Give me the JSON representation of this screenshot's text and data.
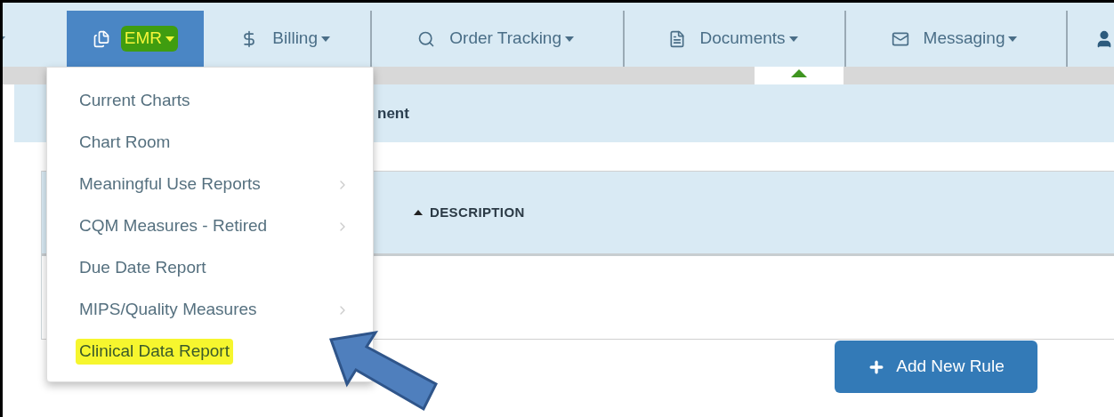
{
  "navbar": {
    "items": [
      {
        "label": "EMR",
        "selected": true,
        "highlighted": true
      },
      {
        "label": "Billing",
        "selected": false,
        "highlighted": false
      },
      {
        "label": "Order Tracking",
        "selected": false,
        "highlighted": false
      },
      {
        "label": "Documents",
        "selected": false,
        "highlighted": false
      },
      {
        "label": "Messaging",
        "selected": false,
        "highlighted": false
      }
    ]
  },
  "emr_menu": {
    "items": [
      {
        "label": "Current Charts",
        "kind": "plain",
        "highlighted": false
      },
      {
        "label": "Chart Room",
        "kind": "plain",
        "highlighted": false
      },
      {
        "label": "Meaningful Use Reports",
        "kind": "submenu",
        "highlighted": false
      },
      {
        "label": "CQM Measures - Retired",
        "kind": "submenu",
        "highlighted": false
      },
      {
        "label": "Due Date Report",
        "kind": "plain",
        "highlighted": false
      },
      {
        "label": "MIPS/Quality Measures",
        "kind": "submenu",
        "highlighted": false
      },
      {
        "label": "Clinical Data Report",
        "kind": "plain",
        "highlighted": true
      }
    ]
  },
  "panel": {
    "title_end": "nent"
  },
  "table": {
    "columns": [
      {
        "label": "DESCRIPTION",
        "sort_ascending": true
      }
    ]
  },
  "add_button": {
    "label": "Add New Rule"
  }
}
